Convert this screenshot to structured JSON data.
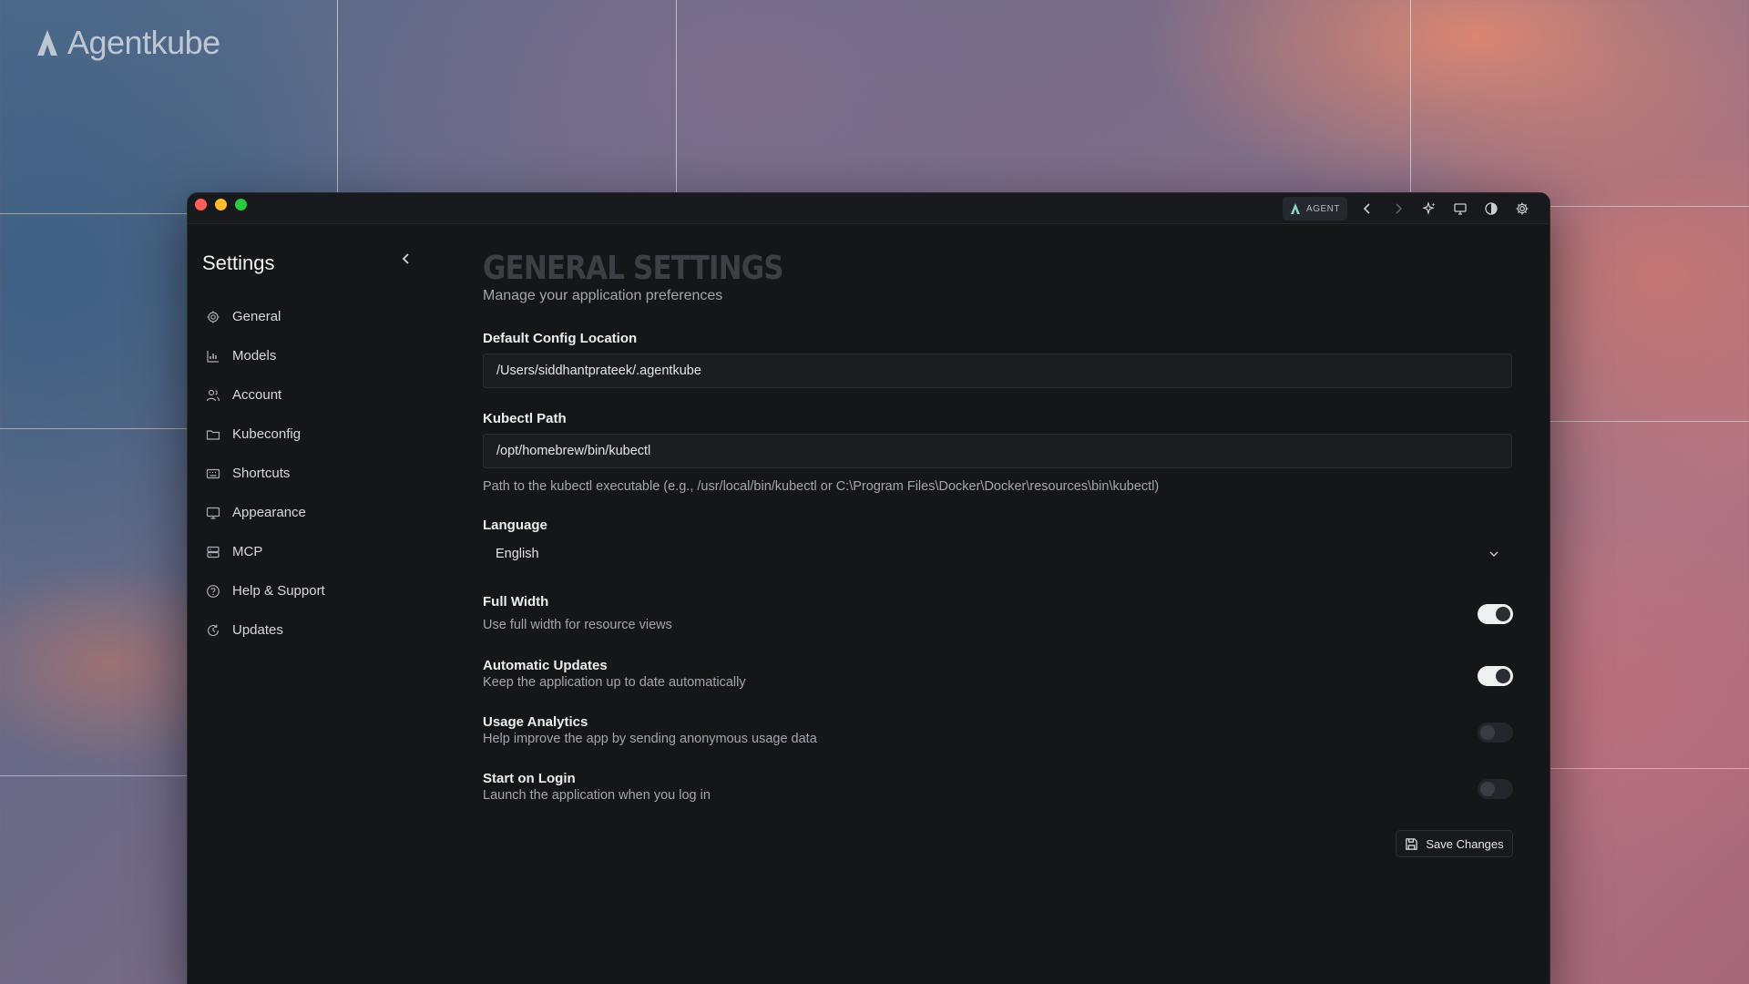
{
  "brand": {
    "name": "Agentkube"
  },
  "titlebar": {
    "agent_label": "AGENT",
    "icons": [
      "agent-logo-icon",
      "chevron-left-icon",
      "chevron-right-icon",
      "sparkles-icon",
      "monitor-icon",
      "contrast-icon",
      "gear-icon"
    ]
  },
  "sidebar": {
    "title": "Settings",
    "items": [
      {
        "label": "General",
        "icon": "gear-icon"
      },
      {
        "label": "Models",
        "icon": "chart-icon"
      },
      {
        "label": "Account",
        "icon": "users-icon"
      },
      {
        "label": "Kubeconfig",
        "icon": "folder-icon"
      },
      {
        "label": "Shortcuts",
        "icon": "keyboard-icon"
      },
      {
        "label": "Appearance",
        "icon": "monitor-icon"
      },
      {
        "label": "MCP",
        "icon": "server-icon"
      },
      {
        "label": "Help & Support",
        "icon": "help-icon"
      },
      {
        "label": "Updates",
        "icon": "refresh-icon"
      }
    ]
  },
  "main": {
    "title": "GENERAL SETTINGS",
    "subtitle": "Manage your application preferences",
    "config_location": {
      "label": "Default Config Location",
      "value": "/Users/siddhantprateek/.agentkube"
    },
    "kubectl": {
      "label": "Kubectl Path",
      "value": "/opt/homebrew/bin/kubectl",
      "hint": "Path to the kubectl executable (e.g., /usr/local/bin/kubectl or C:\\Program Files\\Docker\\Docker\\resources\\bin\\kubectl)"
    },
    "language": {
      "label": "Language",
      "value": "English"
    },
    "toggles": [
      {
        "title": "Full Width",
        "description": "Use full width for resource views",
        "enabled": true
      },
      {
        "title": "Automatic Updates",
        "description": "Keep the application up to date automatically",
        "enabled": true
      },
      {
        "title": "Usage Analytics",
        "description": "Help improve the app by sending anonymous usage data",
        "enabled": false
      },
      {
        "title": "Start on Login",
        "description": "Launch the application when you log in",
        "enabled": false
      }
    ],
    "save_label": "Save Changes"
  },
  "colors": {
    "toggle_on": "#eef0f2",
    "toggle_off": "#23262a",
    "window_bg": "#141618"
  }
}
